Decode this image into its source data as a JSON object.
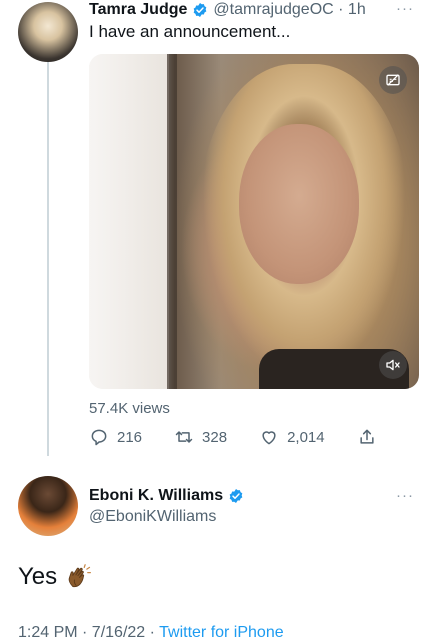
{
  "tweet1": {
    "display_name": "Tamra Judge",
    "handle_time": "@tamrajudgeOC · 1h",
    "more": "···",
    "text": "I have an announcement...",
    "views": "57.4K views",
    "replies": "216",
    "retweets": "328",
    "likes": "2,014"
  },
  "tweet2": {
    "display_name": "Eboni K. Williams",
    "handle": "@EboniKWilliams",
    "more": "···",
    "text": "Yes",
    "meta_time": "1:24 PM · 7/16/22 · ",
    "meta_source": "Twitter for iPhone"
  },
  "icons": {
    "verified": "verified-badge-icon",
    "captions": "captions-off-icon",
    "mute": "muted-speaker-icon",
    "reply": "reply-icon",
    "retweet": "retweet-icon",
    "like": "heart-icon",
    "share": "share-icon",
    "clap": "clapping-hands-emoji"
  },
  "colors": {
    "link_blue": "#1d9bf0",
    "secondary_text": "#536471",
    "thread_line": "#cfd9de"
  }
}
